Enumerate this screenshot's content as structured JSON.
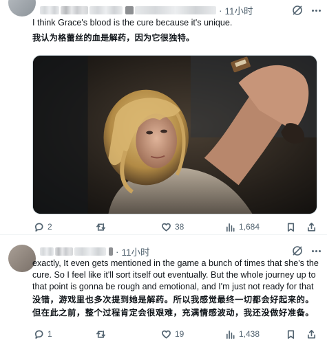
{
  "tweet1": {
    "time": "11小时",
    "separator": "·",
    "text_en": "I think Grace's blood is the cure because it's unique.",
    "text_zh": "我认为格蕾丝的血是解药，因为它很独特。",
    "stats": {
      "replies": "2",
      "retweets": "",
      "likes": "38",
      "views": "1,684"
    }
  },
  "tweet2": {
    "time": "11小时",
    "separator": "·",
    "text_en": "exactly, It even gets mentioned in the game a bunch of times that she's the cure. So I feel like it'll sort itself out eventually. But the whole journey up to that point is gonna be rough and emotional, and I'm just not ready for that",
    "text_zh": "没错，游戏里也多次提到她是解药。所以我感觉最终一切都会好起来的。但在此之前，整个过程肯定会很艰难，充满情感波动，我还没做好准备。",
    "stats": {
      "replies": "1",
      "retweets": "",
      "likes": "19",
      "views": "1,438"
    }
  },
  "icons": {
    "reply": "reply-icon",
    "retweet": "retweet-icon",
    "like": "heart-icon",
    "views": "views-chart-icon",
    "bookmark": "bookmark-icon",
    "share": "share-icon",
    "grok": "grok-icon",
    "more": "more-icon"
  },
  "colors": {
    "text": "#0f1419",
    "secondary": "#536471",
    "border": "#cfd9de"
  }
}
